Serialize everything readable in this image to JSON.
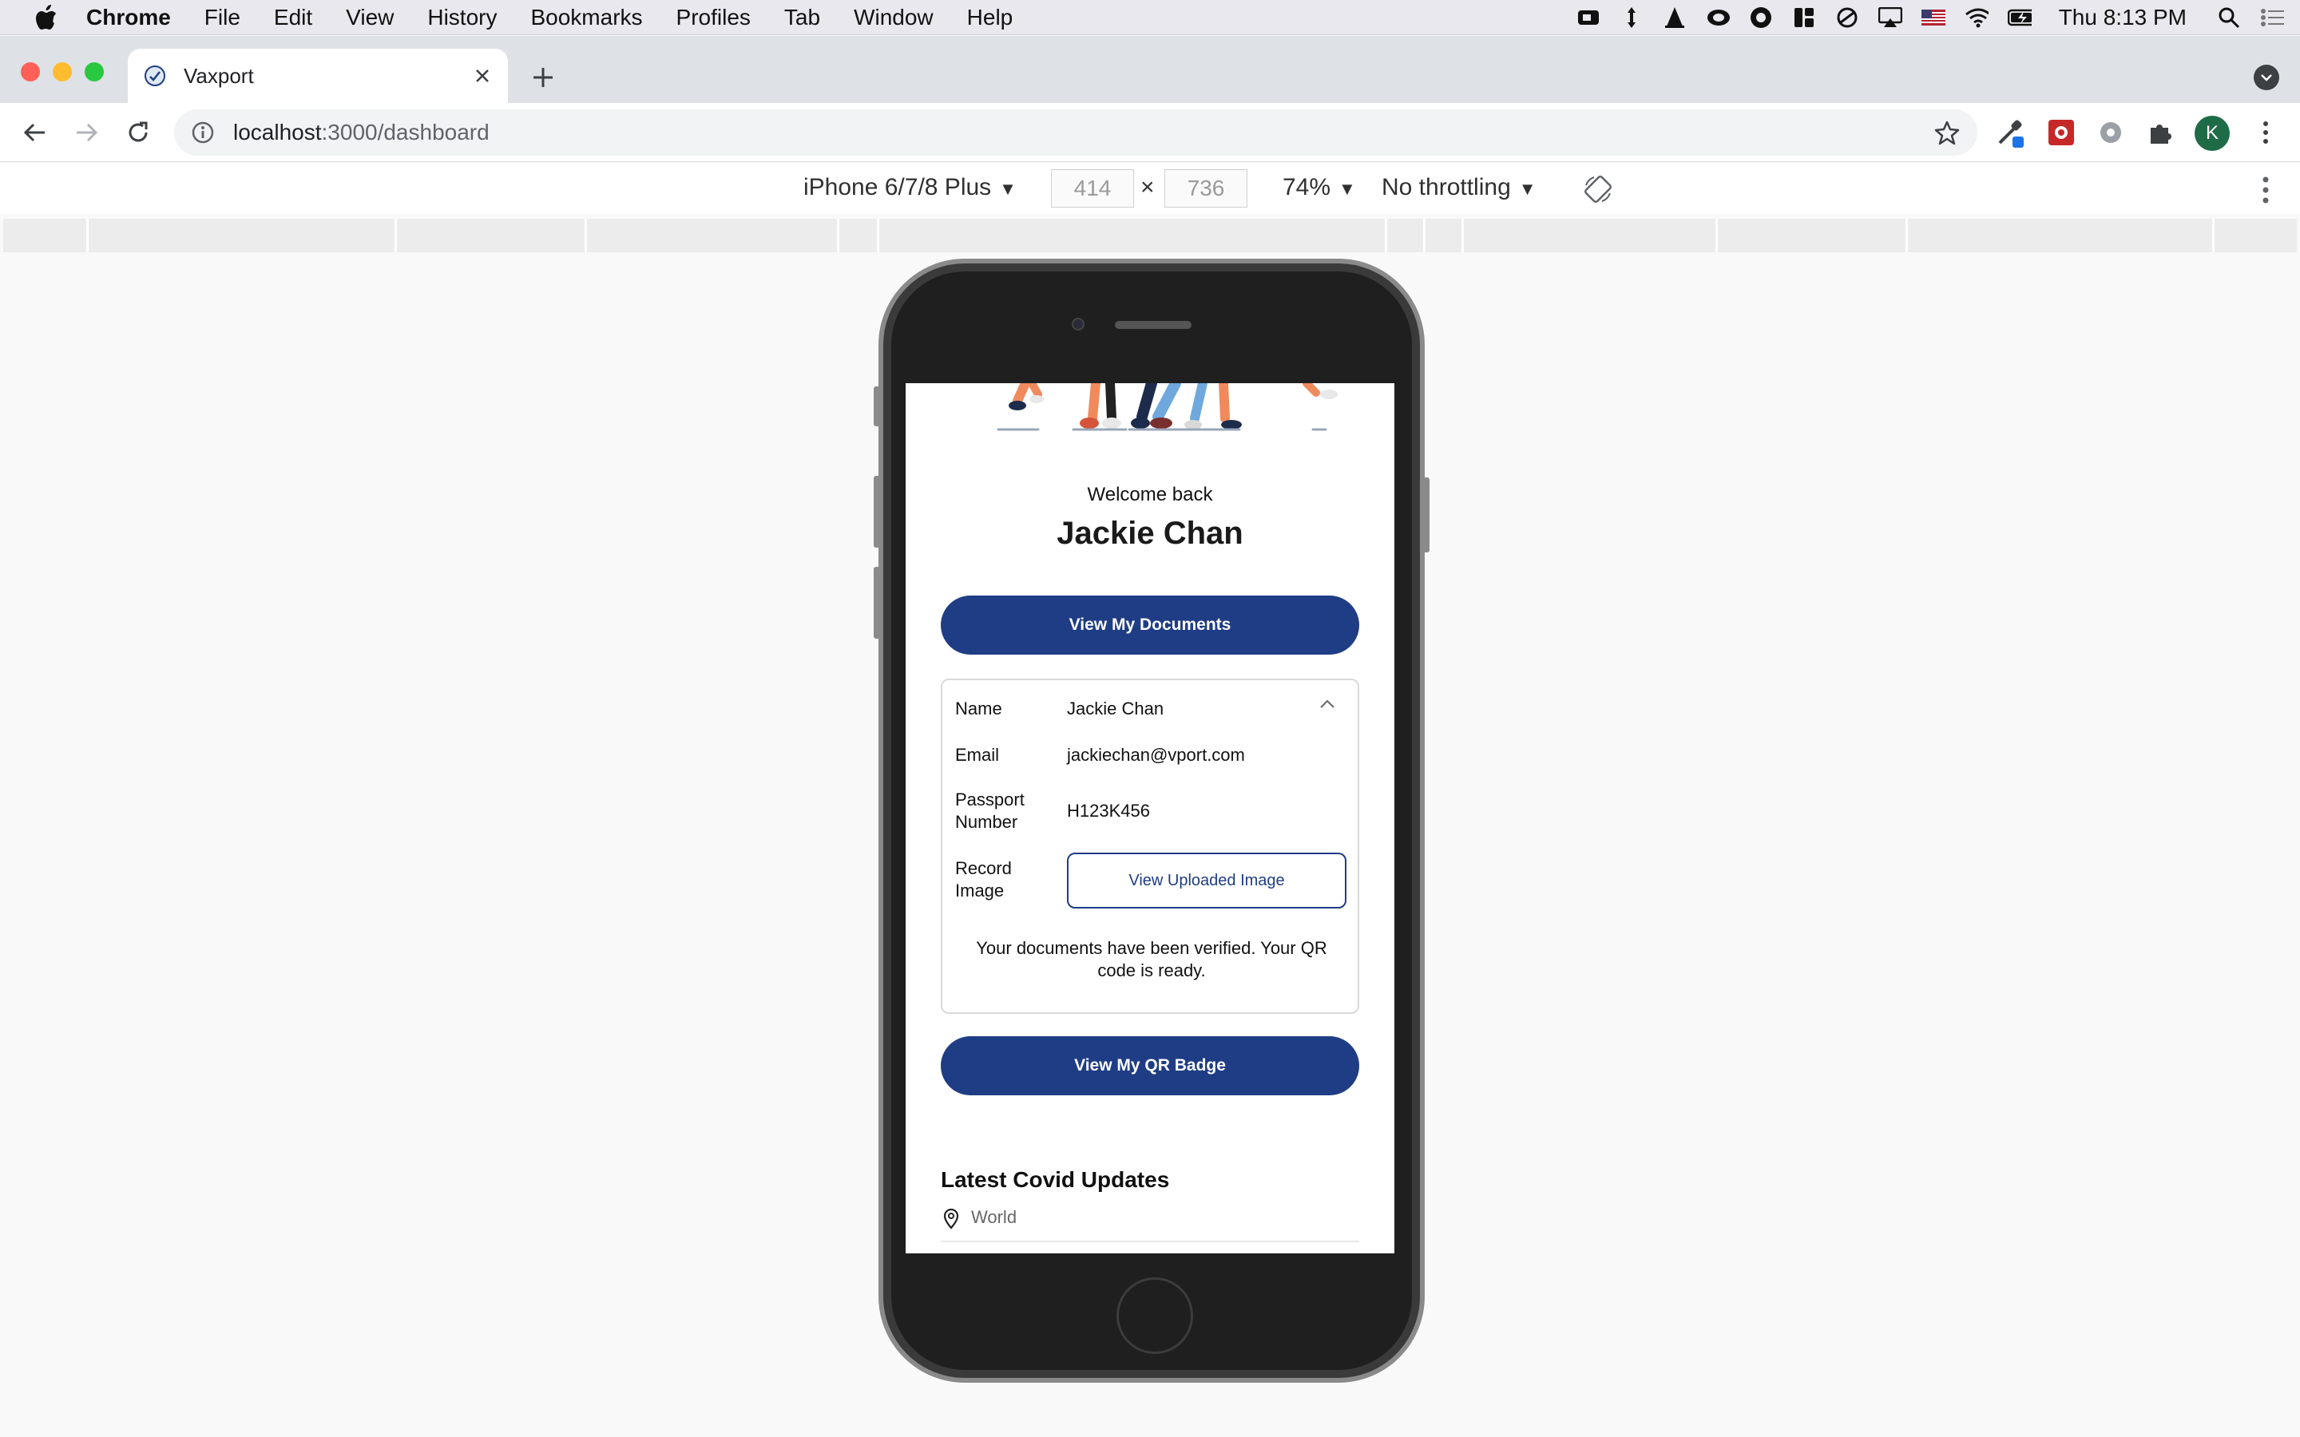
{
  "menubar": {
    "app": "Chrome",
    "items": [
      "File",
      "Edit",
      "View",
      "History",
      "Bookmarks",
      "Profiles",
      "Tab",
      "Window",
      "Help"
    ],
    "clock": "Thu 8:13 PM"
  },
  "browser": {
    "tab_title": "Vaxport",
    "url_host": "localhost",
    "url_path": ":3000/dashboard",
    "profile_initial": "K"
  },
  "devtools": {
    "device": "iPhone 6/7/8 Plus",
    "width": "414",
    "height": "736",
    "times": "×",
    "zoom": "74%",
    "throttling": "No throttling"
  },
  "app": {
    "welcome": "Welcome back",
    "user_name": "Jackie Chan",
    "view_documents_label": "View My Documents",
    "details": {
      "name_label": "Name",
      "name_value": "Jackie Chan",
      "email_label": "Email",
      "email_value": "jackiechan@vport.com",
      "passport_label_line1": "Passport",
      "passport_label_line2": "Number",
      "passport_value": "H123K456",
      "record_label_line1": "Record",
      "record_label_line2": "Image",
      "view_image_label": "View Uploaded Image",
      "verified_message": "Your documents have been verified. Your QR code is ready."
    },
    "view_qr_label": "View My QR Badge",
    "updates_title": "Latest Covid Updates",
    "location": "World"
  },
  "colors": {
    "primary": "#1f3d85",
    "chrome_frame": "#dee1e6",
    "menubar": "#e8e8ee"
  }
}
